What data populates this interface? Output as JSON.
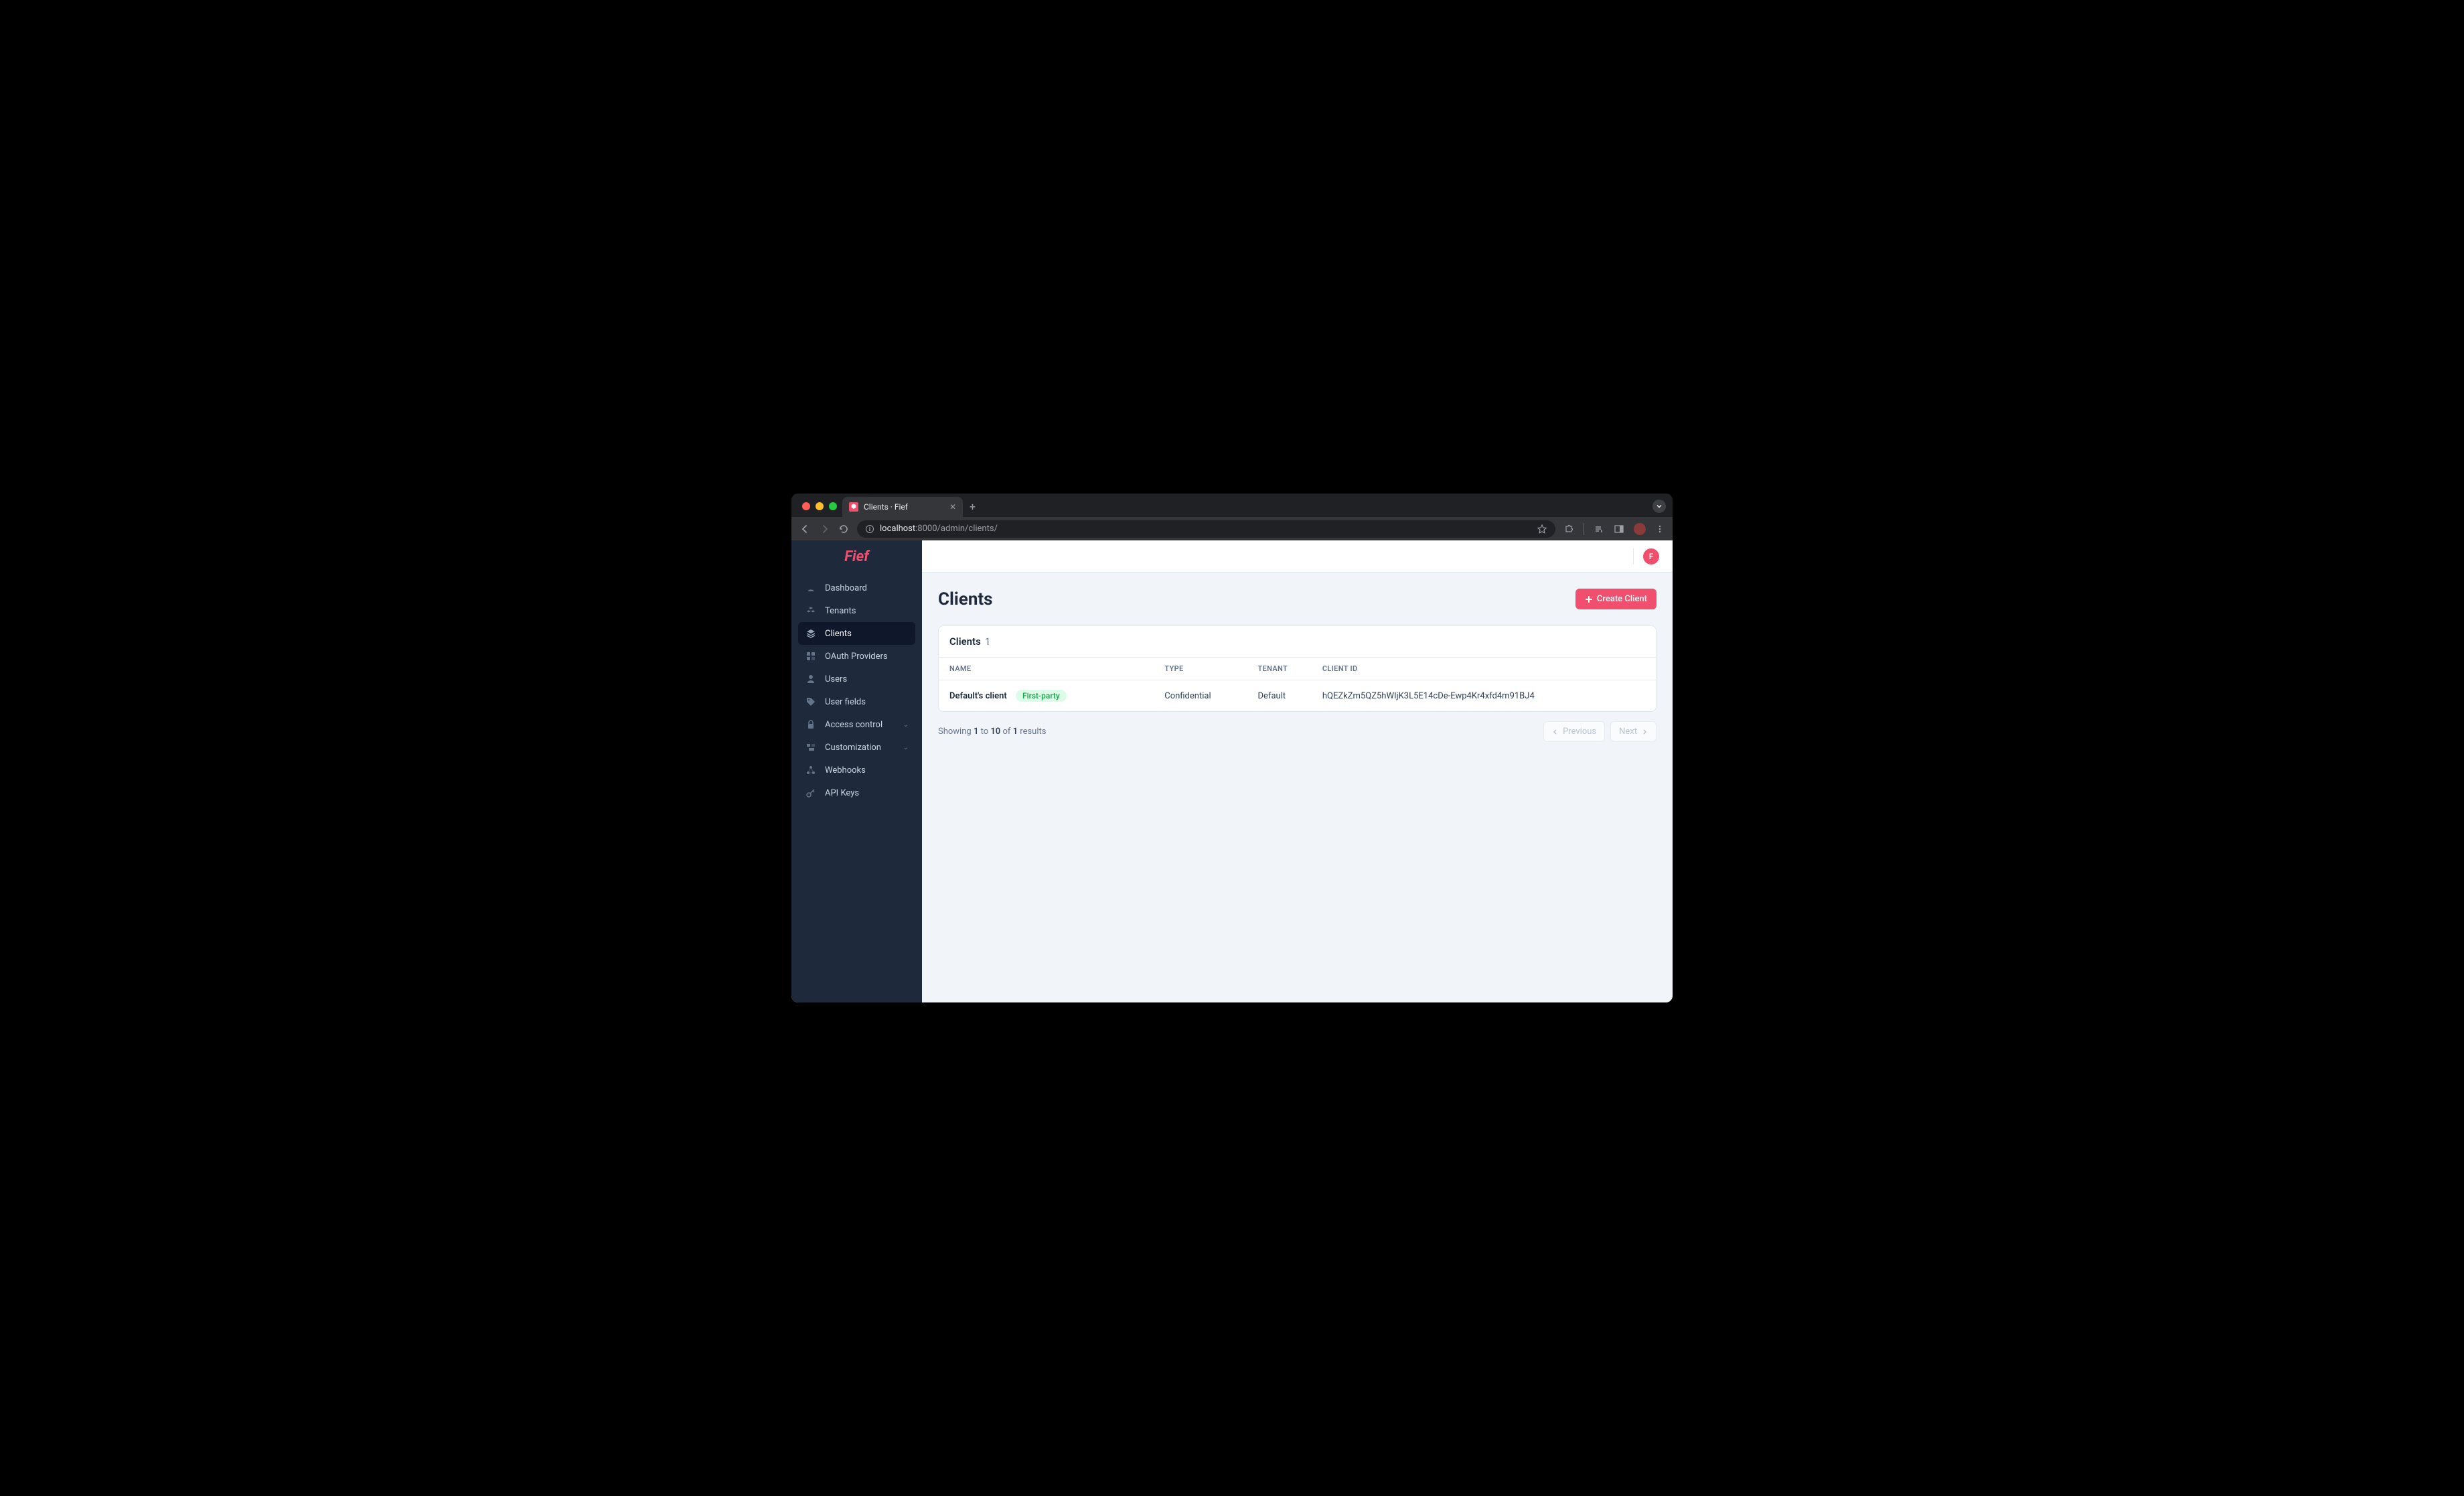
{
  "browser": {
    "tab_title": "Clients · Fief",
    "url_host": "localhost",
    "url_port_path": ":8000/admin/clients/"
  },
  "brand": {
    "name": "Fief",
    "accent": "#f0506e"
  },
  "sidebar": {
    "items": [
      {
        "label": "Dashboard",
        "icon": "dashboard-icon"
      },
      {
        "label": "Tenants",
        "icon": "cubes-icon"
      },
      {
        "label": "Clients",
        "icon": "layers-icon",
        "active": true
      },
      {
        "label": "OAuth Providers",
        "icon": "puzzle-icon"
      },
      {
        "label": "Users",
        "icon": "user-icon"
      },
      {
        "label": "User fields",
        "icon": "tag-icon"
      },
      {
        "label": "Access control",
        "icon": "lock-icon",
        "expandable": true
      },
      {
        "label": "Customization",
        "icon": "slider-icon",
        "expandable": true
      },
      {
        "label": "Webhooks",
        "icon": "webhook-icon"
      },
      {
        "label": "API Keys",
        "icon": "key-icon"
      }
    ]
  },
  "topbar": {
    "avatar_initial": "F"
  },
  "page": {
    "title": "Clients",
    "create_button": "Create Client"
  },
  "card": {
    "title": "Clients",
    "count": "1"
  },
  "table": {
    "headers": {
      "name": "NAME",
      "type": "TYPE",
      "tenant": "TENANT",
      "client_id": "CLIENT ID"
    },
    "rows": [
      {
        "name": "Default's client",
        "badge": "First-party",
        "type": "Confidential",
        "tenant": "Default",
        "client_id": "hQEZkZm5QZ5hWIjK3L5E14cDe-Ewp4Kr4xfd4m91BJ4"
      }
    ]
  },
  "pagination": {
    "showing_prefix": "Showing ",
    "from": "1",
    "to_word": " to ",
    "to": "10",
    "of_word": " of ",
    "total": "1",
    "results_word": " results",
    "prev": "Previous",
    "next": "Next"
  }
}
